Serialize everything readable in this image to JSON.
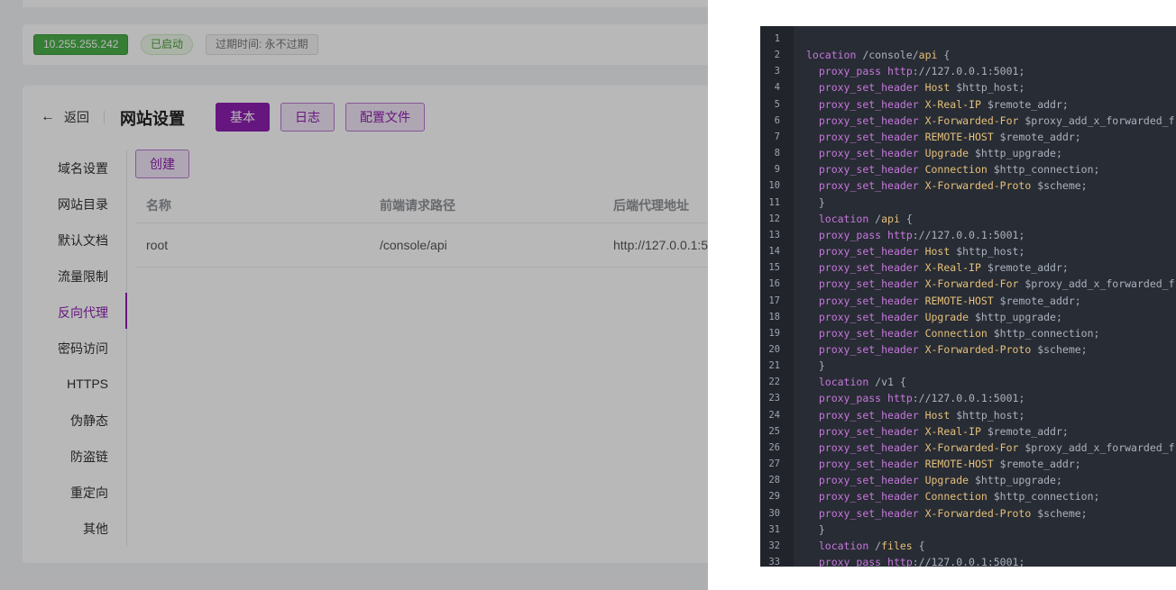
{
  "server": {
    "ip": "10.255.255.242",
    "status": "已启动",
    "expiry": "过期时间: 永不过期"
  },
  "header": {
    "back_label": "返回",
    "title": "网站设置",
    "tabs": [
      "基本",
      "日志",
      "配置文件"
    ]
  },
  "sidebar": {
    "items": [
      "域名设置",
      "网站目录",
      "默认文档",
      "流量限制",
      "反向代理",
      "密码访问",
      "HTTPS",
      "伪静态",
      "防盗链",
      "重定向",
      "其他"
    ],
    "active": "反向代理"
  },
  "proxy": {
    "create_label": "创建",
    "columns": [
      "名称",
      "前端请求路径",
      "后端代理地址"
    ],
    "rows": [
      {
        "name": "root",
        "path": "/console/api",
        "backend": "http://127.0.0.1:5"
      }
    ]
  },
  "editor": {
    "lines": [
      "",
      "location /console/api {",
      "  proxy_pass http://127.0.0.1:5001;",
      "  proxy_set_header Host $http_host;",
      "  proxy_set_header X-Real-IP $remote_addr;",
      "  proxy_set_header X-Forwarded-For $proxy_add_x_forwarded_f",
      "  proxy_set_header REMOTE-HOST $remote_addr;",
      "  proxy_set_header Upgrade $http_upgrade;",
      "  proxy_set_header Connection $http_connection;",
      "  proxy_set_header X-Forwarded-Proto $scheme;",
      "  }",
      "  location /api {",
      "  proxy_pass http://127.0.0.1:5001;",
      "  proxy_set_header Host $http_host;",
      "  proxy_set_header X-Real-IP $remote_addr;",
      "  proxy_set_header X-Forwarded-For $proxy_add_x_forwarded_f",
      "  proxy_set_header REMOTE-HOST $remote_addr;",
      "  proxy_set_header Upgrade $http_upgrade;",
      "  proxy_set_header Connection $http_connection;",
      "  proxy_set_header X-Forwarded-Proto $scheme;",
      "  }",
      "  location /v1 {",
      "  proxy_pass http://127.0.0.1:5001;",
      "  proxy_set_header Host $http_host;",
      "  proxy_set_header X-Real-IP $remote_addr;",
      "  proxy_set_header X-Forwarded-For $proxy_add_x_forwarded_f",
      "  proxy_set_header REMOTE-HOST $remote_addr;",
      "  proxy_set_header Upgrade $http_upgrade;",
      "  proxy_set_header Connection $http_connection;",
      "  proxy_set_header X-Forwarded-Proto $scheme;",
      "  }",
      "  location /files {",
      "  proxy_pass http://127.0.0.1:5001;"
    ]
  },
  "colors": {
    "accent": "#8e1fb0",
    "success": "#4cae4c",
    "editor_bg": "#282c34"
  }
}
